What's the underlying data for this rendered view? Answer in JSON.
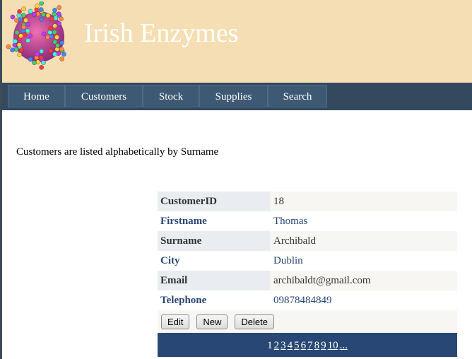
{
  "header": {
    "title": "Irish Enzymes",
    "logo_icon": "molecule-sphere-icon"
  },
  "nav": {
    "items": [
      "Home",
      "Customers",
      "Stock",
      "Supplies",
      "Search"
    ]
  },
  "intro": "Customers are listed alphabetically by Surname",
  "record": {
    "fields": [
      {
        "label": "CustomerID",
        "value": "18"
      },
      {
        "label": "Firstname",
        "value": "Thomas"
      },
      {
        "label": "Surname",
        "value": "Archibald"
      },
      {
        "label": "City",
        "value": "Dublin"
      },
      {
        "label": "Email",
        "value": "archibaldt@gmail.com"
      },
      {
        "label": "Telephone",
        "value": "09878484849"
      }
    ]
  },
  "actions": {
    "edit": "Edit",
    "new": "New",
    "delete": "Delete"
  },
  "pager": {
    "current": "1",
    "pages": [
      "2",
      "3",
      "4",
      "5",
      "6",
      "7",
      "8",
      "9",
      "10",
      "..."
    ]
  },
  "colors": {
    "header_bg": "#f5deb3",
    "nav_bg": "#34495e",
    "pager_bg": "#284775",
    "label_accent": "#284775"
  }
}
